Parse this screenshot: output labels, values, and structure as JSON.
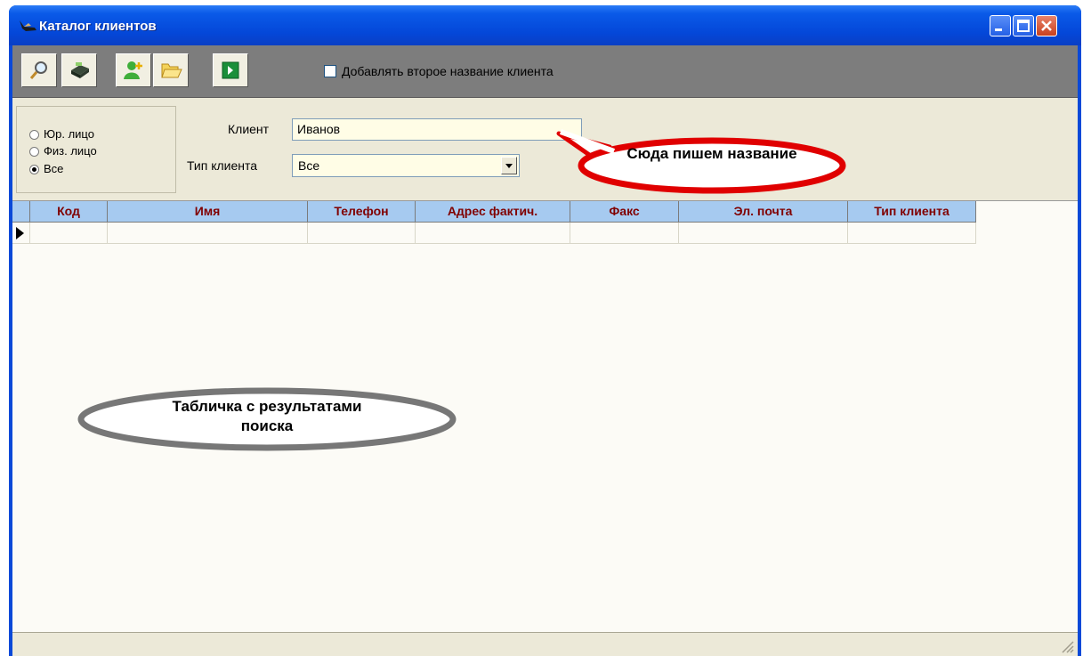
{
  "window": {
    "title": "Каталог клиентов"
  },
  "toolbar": {
    "buttons": [
      {
        "icon": "magnifier-icon"
      },
      {
        "icon": "cash-register-icon"
      },
      {
        "icon": "add-user-icon"
      },
      {
        "icon": "open-folder-icon"
      },
      {
        "icon": "green-arrow-right-icon"
      }
    ],
    "checkbox_label": "Добавлять второе название клиента",
    "checkbox_checked": false
  },
  "filter": {
    "radios": [
      {
        "label": "Юр. лицо",
        "selected": false
      },
      {
        "label": "Физ. лицо",
        "selected": false
      },
      {
        "label": "Все",
        "selected": true
      }
    ],
    "client_label": "Клиент",
    "client_value": "Иванов",
    "type_label": "Тип клиента",
    "type_value": "Все"
  },
  "table": {
    "columns": [
      "Код",
      "Имя",
      "Телефон",
      "Адрес фактич.",
      "Факс",
      "Эл. почта",
      "Тип клиента"
    ],
    "rows": [
      [
        "",
        "",
        "",
        "",
        "",
        "",
        ""
      ]
    ]
  },
  "annotations": {
    "field_hint": "Сюда пишем название",
    "table_hint": "Табличка с результатами поиска"
  },
  "colors": {
    "titlebar": "#0a49d8",
    "header_bg": "#a6caf0",
    "header_text": "#800000",
    "callout_red": "#e00000",
    "callout_gray": "#777777"
  }
}
